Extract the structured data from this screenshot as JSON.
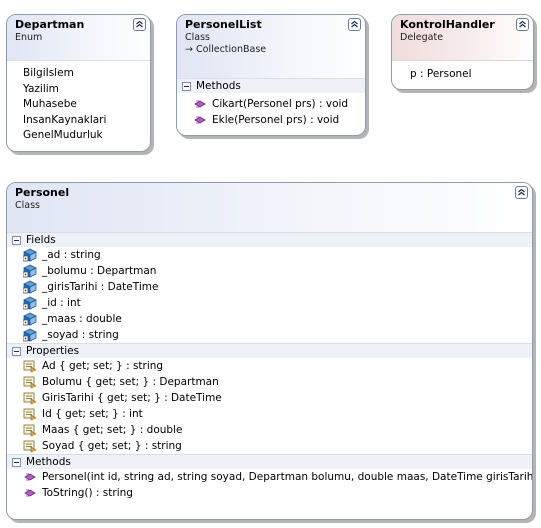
{
  "departman": {
    "title": "Departman",
    "stereotype": "Enum",
    "items": [
      "BilgiIslem",
      "Yazilim",
      "Muhasebe",
      "InsanKaynaklari",
      "GenelMudurluk"
    ]
  },
  "personel_list": {
    "title": "PersonelList",
    "stereotype": "Class",
    "base": "CollectionBase",
    "methods_title": "Methods",
    "methods": [
      "Cikart(Personel prs) : void",
      "Ekle(Personel prs) : void"
    ]
  },
  "kontrol_handler": {
    "title": "KontrolHandler",
    "stereotype": "Delegate",
    "param": "p : Personel"
  },
  "personel": {
    "title": "Personel",
    "stereotype": "Class",
    "fields_title": "Fields",
    "fields": [
      "_ad : string",
      "_bolumu : Departman",
      "_girisTarihi : DateTime",
      "_id : int",
      "_maas : double",
      "_soyad : string"
    ],
    "properties_title": "Properties",
    "properties": [
      "Ad { get; set; } : string",
      "Bolumu { get; set; } : Departman",
      "GirisTarihi { get; set; } : DateTime",
      "Id { get; set; } : int",
      "Maas { get; set; } : double",
      "Soyad { get; set; } : string"
    ],
    "methods_title": "Methods",
    "methods": [
      "Personel(int id, string ad, string soyad, Departman bolumu, double maas, DateTime girisTarihi)",
      "ToString() : string"
    ]
  },
  "icons": {
    "field": "field-icon",
    "property": "property-icon",
    "method": "method-icon",
    "inherit": "inheritance-arrow-icon",
    "collapse": "collapse-chevron-icon"
  },
  "colors": {
    "border": "#8d9db1",
    "header_gradient": "#dfe5f4",
    "delegate_gradient": "#f0dcdc",
    "method_icon": "#b25cc6",
    "field_icon": "#2f6fb8",
    "property_icon": "#d9b23a"
  }
}
